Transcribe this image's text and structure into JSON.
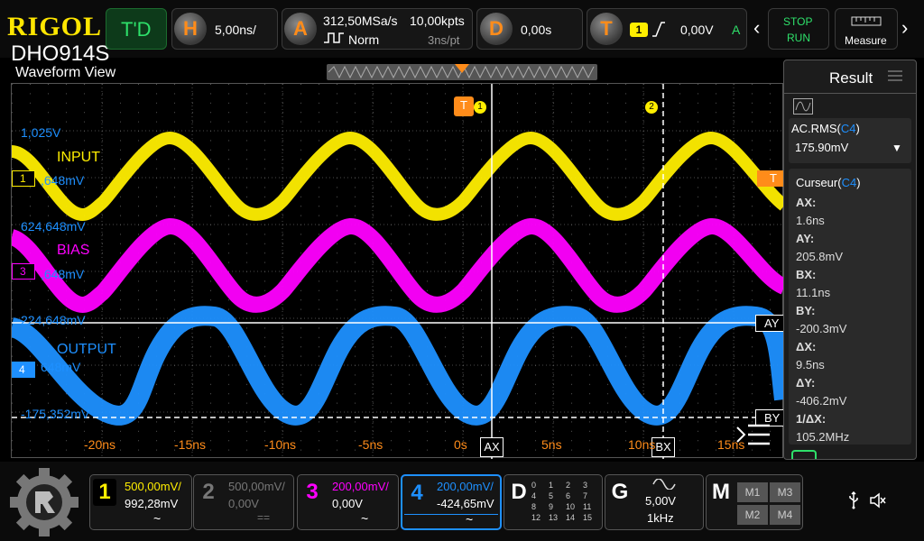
{
  "brand": {
    "logo": "RIGOL",
    "model": "DHO914S"
  },
  "header": {
    "view_title": "Waveform View",
    "trigger_mode_label": "T'D",
    "horizontal": {
      "icon": "H",
      "timebase": "5,00ns/"
    },
    "acquire": {
      "icon": "A",
      "sample_rate": "312,50MSa/s",
      "mode": "Norm",
      "points": "10,00kpts",
      "resolution": "3ns/pt"
    },
    "delay": {
      "icon": "D",
      "value": "0,00s"
    },
    "trigger": {
      "icon": "T",
      "source": "1",
      "level": "0,00V",
      "coupling": "A"
    },
    "stop_run": {
      "stop": "STOP",
      "run": "RUN"
    },
    "measure_label": "Measure"
  },
  "waveform": {
    "channel_labels": {
      "input": "INPUT",
      "bias": "BIAS",
      "output": "OUTPUT"
    },
    "offset_labels": [
      "1,025V",
      ",648mV",
      "624,648mV",
      ",648mV",
      "224,648mV",
      "648mV",
      "-175,352mV"
    ],
    "channel_markers": [
      "1",
      "3",
      "4"
    ],
    "trigger_marker": "T",
    "cursor_tags": {
      "t1": "1",
      "t2": "2",
      "ax": "AX",
      "bx": "BX",
      "ay": "AY",
      "by": "BY"
    },
    "time_ticks": [
      "-20ns",
      "-15ns",
      "-10ns",
      "-5ns",
      "0s",
      "5ns",
      "10ns",
      "15ns"
    ]
  },
  "result": {
    "title": "Result",
    "measurement": {
      "label": "AC.RMS(",
      "channel": "C4",
      "close": ")",
      "value": "175.90mV"
    },
    "cursor": {
      "label": "Curseur(",
      "channel": "C4",
      "close": ")"
    },
    "rows": [
      {
        "name": "AX:",
        "value": "1.6ns"
      },
      {
        "name": "AY:",
        "value": "205.8mV"
      },
      {
        "name": "BX:",
        "value": "11.1ns"
      },
      {
        "name": "BY:",
        "value": "-200.3mV"
      },
      {
        "name": "ΔX:",
        "value": "9.5ns"
      },
      {
        "name": "ΔY:",
        "value": "-406.2mV"
      },
      {
        "name": "1/ΔX:",
        "value": "105.2MHz"
      }
    ]
  },
  "channels": [
    {
      "num": "1",
      "scale": "500,00mV/",
      "offset": "992,28mV",
      "coupling": "~",
      "color": "#ffee00"
    },
    {
      "num": "2",
      "scale": "500,00mV/",
      "offset": "0,00V",
      "coupling": "==",
      "color": "#777777"
    },
    {
      "num": "3",
      "scale": "200,00mV/",
      "offset": "0,00V",
      "coupling": "~",
      "color": "#ff00ff"
    },
    {
      "num": "4",
      "scale": "200,00mV/",
      "offset": "-424,65mV",
      "coupling": "~",
      "color": "#1e90ff"
    }
  ],
  "digital": {
    "label": "D",
    "bits": [
      "0",
      "1",
      "2",
      "3",
      "4",
      "5",
      "6",
      "7",
      "8",
      "9",
      "10",
      "11",
      "12",
      "13",
      "14",
      "15"
    ]
  },
  "generator": {
    "label": "G",
    "amplitude": "5,00V",
    "frequency": "1kHz"
  },
  "math": {
    "label": "M",
    "items": [
      "M1",
      "M3",
      "M2",
      "M4"
    ]
  },
  "colors": {
    "ch1": "#ffee00",
    "ch3": "#ff00ff",
    "ch4": "#1e90ff",
    "trigger": "#ff8c1a",
    "accent": "#00d060"
  }
}
